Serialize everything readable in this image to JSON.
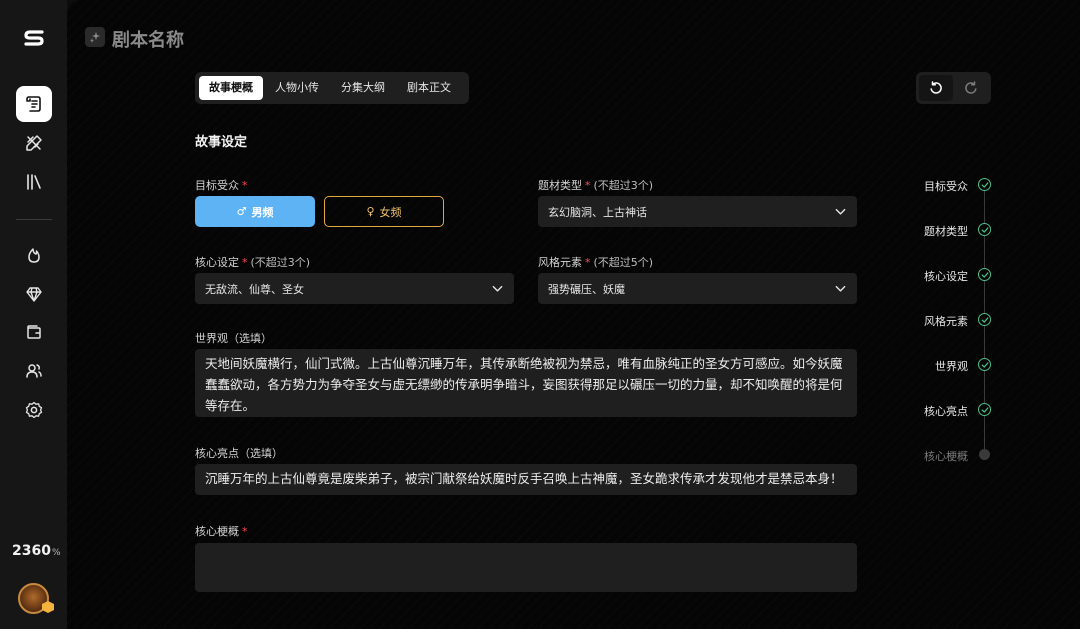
{
  "sidebar": {
    "points": "2360",
    "points_unit": "%"
  },
  "header": {
    "title": "剧本名称"
  },
  "tabs": [
    {
      "label": "故事梗概",
      "active": true
    },
    {
      "label": "人物小传",
      "active": false
    },
    {
      "label": "分集大纲",
      "active": false
    },
    {
      "label": "剧本正文",
      "active": false
    }
  ],
  "form": {
    "section_title": "故事设定",
    "audience": {
      "label": "目标受众",
      "required": "*",
      "male_label": "男频",
      "female_label": "女频"
    },
    "genre": {
      "label": "题材类型",
      "required": "*",
      "hint": "(不超过3个)",
      "value": "玄幻脑洞、上古神话"
    },
    "core_setting": {
      "label": "核心设定",
      "required": "*",
      "hint": "(不超过3个)",
      "value": "无敌流、仙尊、圣女"
    },
    "style": {
      "label": "风格元素",
      "required": "*",
      "hint": "(不超过5个)",
      "value": "强势碾压、妖魔"
    },
    "worldview": {
      "label": "世界观（选填）",
      "value": "天地间妖魔横行，仙门式微。上古仙尊沉睡万年，其传承断绝被视为禁忌，唯有血脉纯正的圣女方可感应。如今妖魔蠢蠢欲动，各方势力为争夺圣女与虚无缥缈的传承明争暗斗，妄图获得那足以碾压一切的力量，却不知唤醒的将是何等存在。"
    },
    "highlight": {
      "label": "核心亮点（选填）",
      "value": "沉睡万年的上古仙尊竟是废柴弟子，被宗门献祭给妖魔时反手召唤上古神魔，圣女跪求传承才发现他才是禁忌本身！"
    },
    "synopsis": {
      "label": "核心梗概",
      "required": "*",
      "value": ""
    }
  },
  "progress": [
    {
      "label": "目标受众",
      "done": true
    },
    {
      "label": "题材类型",
      "done": true
    },
    {
      "label": "核心设定",
      "done": true
    },
    {
      "label": "风格元素",
      "done": true
    },
    {
      "label": "世界观",
      "done": true
    },
    {
      "label": "核心亮点",
      "done": true
    },
    {
      "label": "核心梗概",
      "done": false
    }
  ],
  "colors": {
    "accent_blue": "#5eb3f5",
    "accent_gold": "#e0a843",
    "check_green": "#4ac08a",
    "required_red": "#ff4d4f"
  }
}
